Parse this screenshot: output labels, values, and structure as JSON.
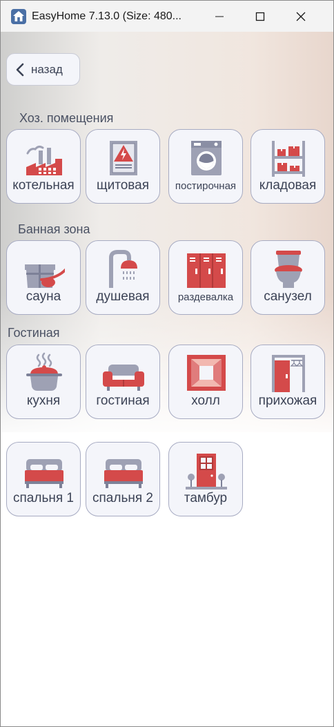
{
  "window": {
    "title": "EasyHome 7.13.0 (Size: 480..."
  },
  "nav": {
    "back_label": "назад"
  },
  "sections": [
    {
      "label": "Хоз. помещения",
      "rooms": [
        "котельная",
        "щитовая",
        "постирочная",
        "кладовая"
      ]
    },
    {
      "label": "Банная зона",
      "rooms": [
        "сауна",
        "душевая",
        "раздевалка",
        "санузел"
      ]
    },
    {
      "label": "Гостиная",
      "rooms": [
        "кухня",
        "гостиная",
        "холл",
        "прихожая",
        "спальня 1",
        "спальня 2",
        "тамбур"
      ]
    }
  ],
  "icons": {
    "boiler": "factory-icon",
    "switchboard": "electrical-panel-icon",
    "laundry": "washing-machine-icon",
    "storage": "shelf-boxes-icon",
    "sauna": "sauna-bucket-ladle-icon",
    "shower": "shower-icon",
    "locker": "lockers-icon",
    "toilet": "toilet-icon",
    "kitchen": "cooking-pot-icon",
    "living": "sofa-icon",
    "hall": "corridor-icon",
    "hallway": "wardrobe-icon",
    "bedroom": "bed-icon",
    "vestibule": "front-door-icon"
  },
  "colors": {
    "accent_red": "#d44a4a",
    "icon_gray": "#9ea1b4",
    "tile_bg": "#f4f5fa",
    "text": "#3c4356"
  }
}
